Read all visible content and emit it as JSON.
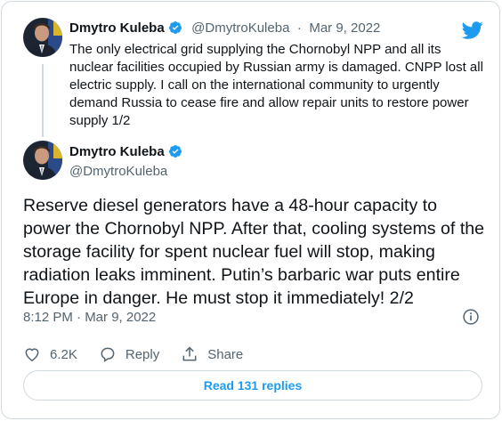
{
  "colors": {
    "accent": "#1d9bf0",
    "text": "#0f1419",
    "secondary": "#536471",
    "border": "#cfd9de"
  },
  "reply_tweet": {
    "author_name": "Dmytro Kuleba",
    "handle": "@DmytroKuleba",
    "separator": "·",
    "date": "Mar 9, 2022",
    "text": "The only electrical grid supplying the Chornobyl NPP and all its nuclear facilities occupied by Russian army is damaged. CNPP lost all electric supply. I call on the international community to urgently demand Russia to cease fire and allow repair units to restore power supply 1/2"
  },
  "main_tweet": {
    "author_name": "Dmytro Kuleba",
    "handle": "@DmytroKuleba",
    "text": "Reserve diesel generators have a 48-hour capacity to power the Chornobyl NPP. After that, cooling systems of the storage facility for spent nuclear fuel will stop, making radiation leaks imminent. Putin’s barbaric war puts entire Europe in danger. He must stop it immediately! 2/2",
    "timestamp": "8:12 PM · Mar 9, 2022",
    "likes": "6.2K",
    "reply_label": "Reply",
    "share_label": "Share",
    "read_replies": "Read 131 replies"
  },
  "icons": [
    "twitter-logo-icon",
    "verified-badge-icon",
    "info-icon",
    "heart-icon",
    "reply-bubble-icon",
    "share-icon"
  ]
}
